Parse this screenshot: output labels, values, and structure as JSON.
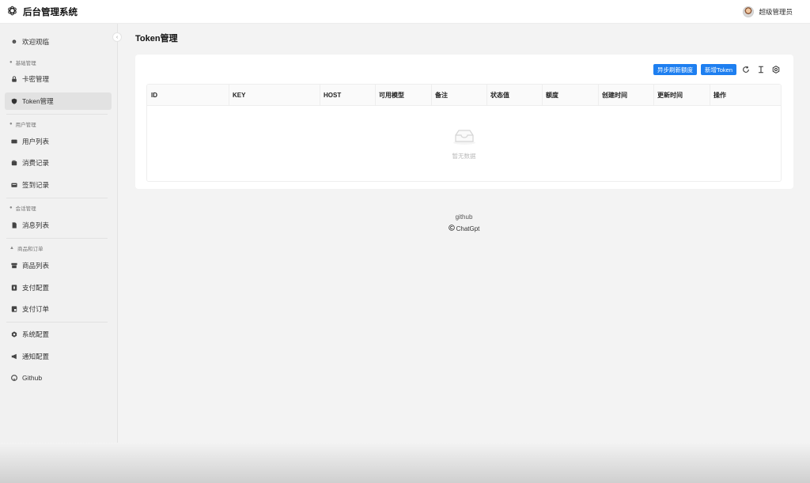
{
  "header": {
    "title": "后台管理系统",
    "user_name": "超级管理员",
    "logo_icon": "openai-logo-icon"
  },
  "sidebar": {
    "items": [
      {
        "label": "欢迎观临",
        "icon": "smile-icon"
      },
      {
        "label": "卡密管理",
        "icon": "lock-icon"
      },
      {
        "label": "Token管理",
        "icon": "shield-icon",
        "active": true
      },
      {
        "label": "用户列表",
        "icon": "id-card-icon"
      },
      {
        "label": "消费记录",
        "icon": "wallet-icon"
      },
      {
        "label": "签到记录",
        "icon": "calendar-icon"
      },
      {
        "label": "消息列表",
        "icon": "file-icon"
      },
      {
        "label": "商品列表",
        "icon": "shop-icon"
      },
      {
        "label": "支付配置",
        "icon": "pay-icon"
      },
      {
        "label": "支付订单",
        "icon": "order-icon"
      },
      {
        "label": "系统配置",
        "icon": "gear-icon"
      },
      {
        "label": "通知配置",
        "icon": "megaphone-icon"
      },
      {
        "label": "Github",
        "icon": "github-icon"
      }
    ],
    "groups": [
      {
        "label": "基础管理",
        "icon": "user-icon"
      },
      {
        "label": "用户管理",
        "icon": "team-icon"
      },
      {
        "label": "会话管理",
        "icon": "chat-icon"
      },
      {
        "label": "商品和订单",
        "icon": "bank-icon"
      }
    ]
  },
  "main": {
    "page_title": "Token管理",
    "toolbar": {
      "refresh_quota_label": "异步刷新额度",
      "add_token_label": "新增Token"
    },
    "table": {
      "columns": [
        "ID",
        "KEY",
        "HOST",
        "可用模型",
        "备注",
        "状态值",
        "额度",
        "创建时间",
        "更新时间",
        "操作"
      ],
      "empty_text": "暂无数据"
    }
  },
  "footer": {
    "link": "github",
    "copyright": "ChatGpt"
  },
  "colors": {
    "accent": "#1e7ff0",
    "background": "#f3f3f3",
    "sidebar": "#f1f1f1"
  }
}
